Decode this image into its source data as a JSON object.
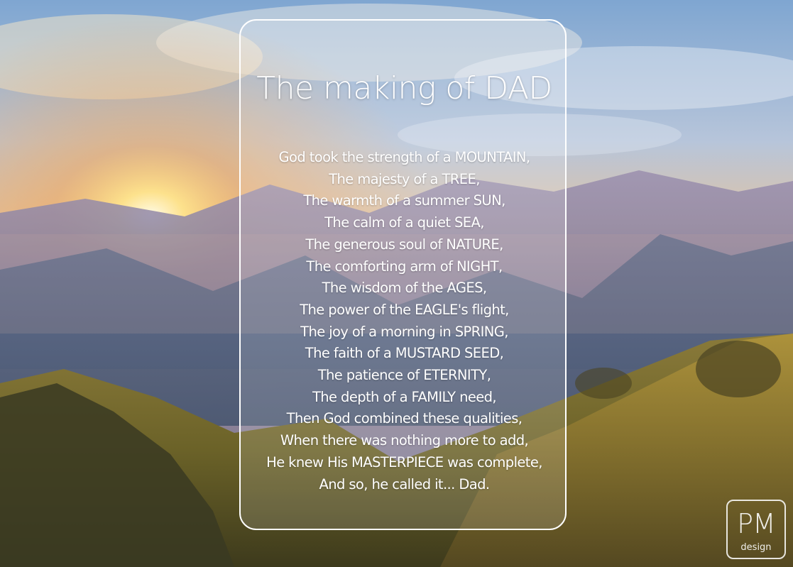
{
  "title": "The making of DAD",
  "poem_lines": [
    "God took the strength of a MOUNTAIN,",
    "The majesty of a TREE,",
    "The warmth of a summer SUN,",
    "The calm of a quiet SEA,",
    "The generous soul of NATURE,",
    "The comforting arm of NIGHT,",
    "The wisdom of the AGES,",
    "The power of the EAGLE's flight,",
    "The joy of a morning in SPRING,",
    "The faith of a MUSTARD SEED,",
    "The patience of ETERNITY,",
    "The depth of a FAMILY need,",
    "Then God combined these qualities,",
    "When there was nothing more to add,",
    "He knew His MASTERPIECE was complete,",
    "And so, he called it... Dad."
  ],
  "logo": {
    "monogram": "PM",
    "subtitle": "design"
  },
  "colors": {
    "text": "#ffffff",
    "sky": "#8fb2d6",
    "sun": "#ffe9a8",
    "mountains": "#4e5f7b",
    "foreground": "#5a5a40"
  }
}
